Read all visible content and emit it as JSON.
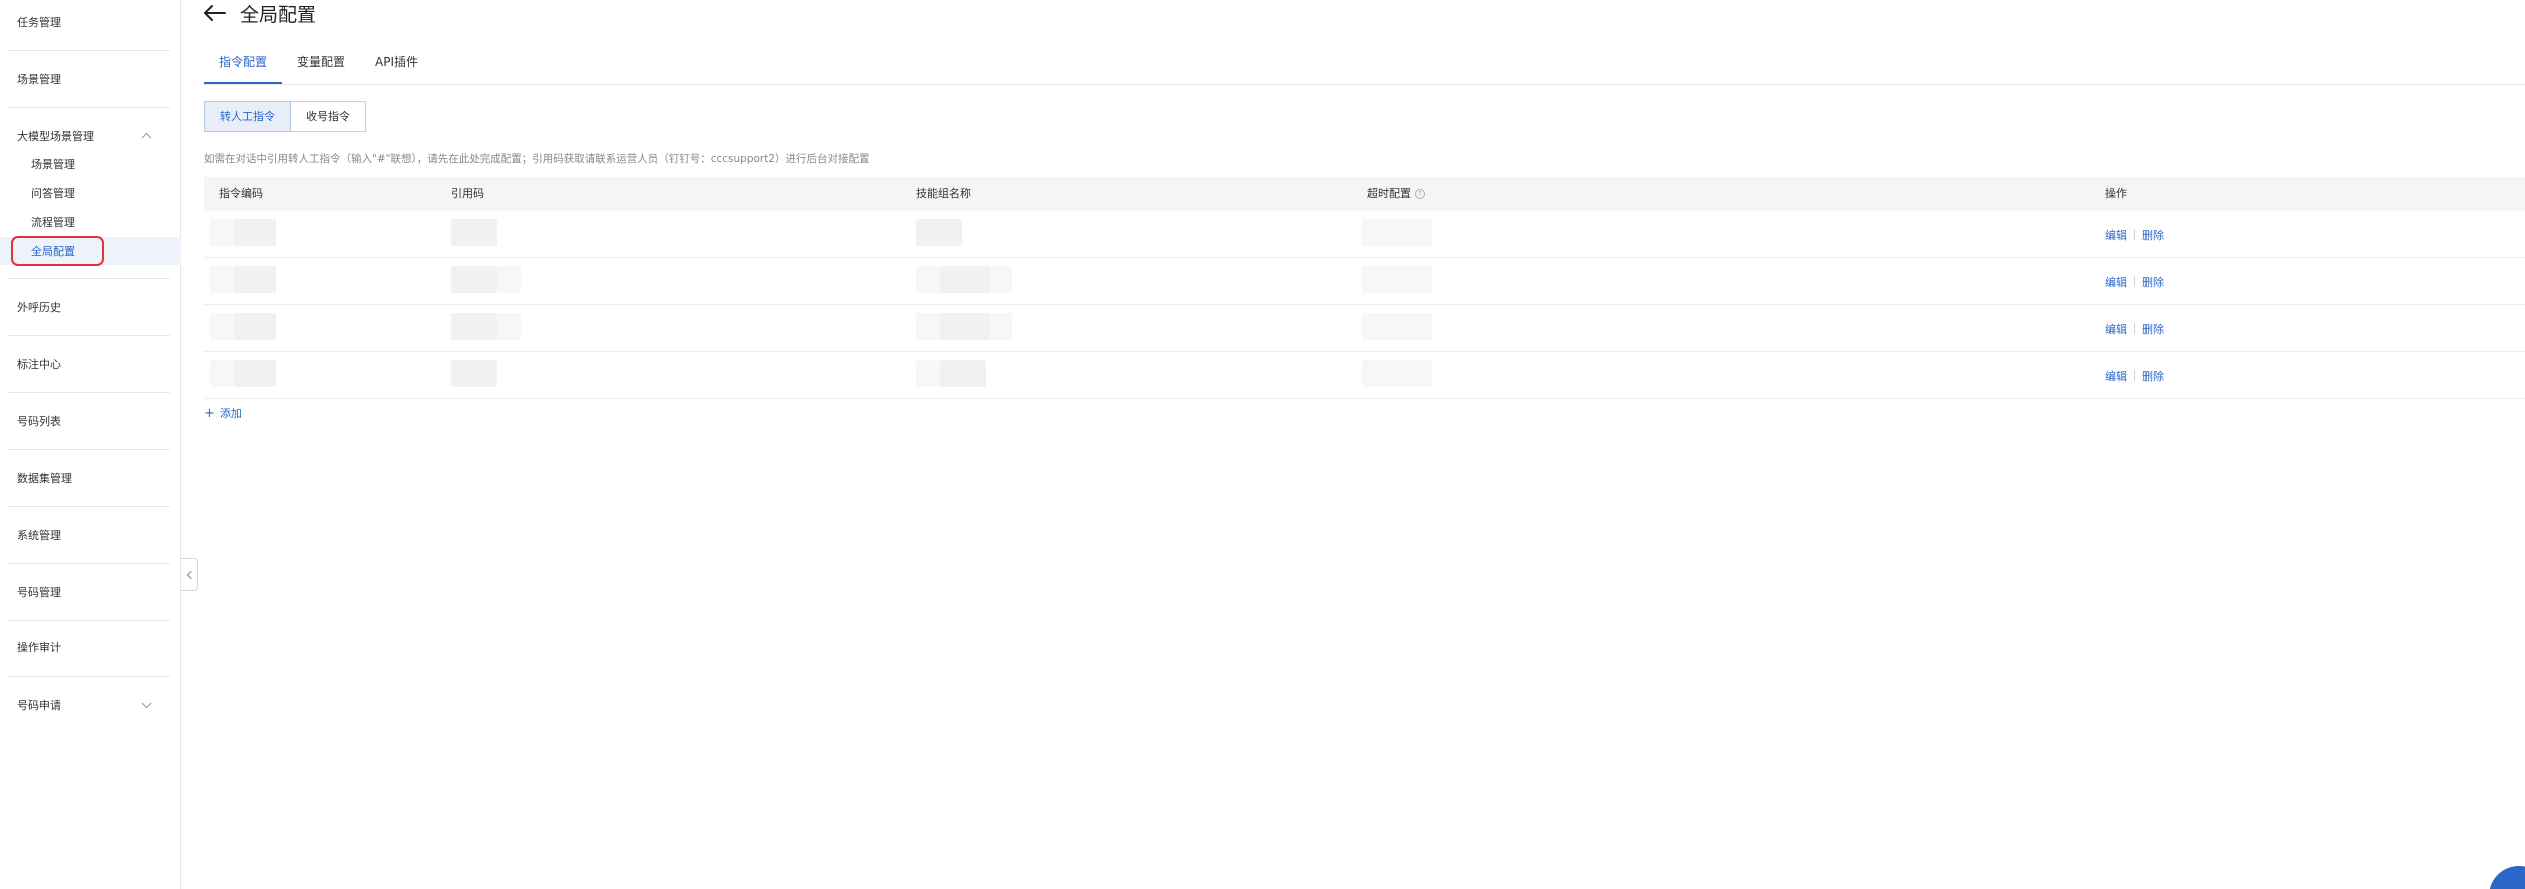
{
  "sidebar": {
    "items": [
      {
        "label": "任务管理"
      },
      {
        "label": "场景管理"
      },
      {
        "label": "大模型场景管理",
        "expanded": true,
        "children": [
          {
            "label": "场景管理"
          },
          {
            "label": "问答管理"
          },
          {
            "label": "流程管理"
          },
          {
            "label": "全局配置",
            "active": true
          }
        ]
      },
      {
        "label": "外呼历史"
      },
      {
        "label": "标注中心"
      },
      {
        "label": "号码列表"
      },
      {
        "label": "数据集管理"
      },
      {
        "label": "系统管理"
      },
      {
        "label": "号码管理"
      },
      {
        "label": "操作审计"
      },
      {
        "label": "号码申请",
        "expanded": false
      }
    ]
  },
  "header": {
    "title": "全局配置",
    "back_icon": "arrow-left-icon"
  },
  "tabs": [
    {
      "label": "指令配置",
      "active": true
    },
    {
      "label": "变量配置"
    },
    {
      "label": "API插件"
    }
  ],
  "segments": [
    {
      "label": "转人工指令",
      "active": true
    },
    {
      "label": "收号指令"
    }
  ],
  "hint": "如需在对话中引用转人工指令（输入\"#\"联想），请先在此处完成配置；引用码获取请联系运营人员（钉钉号：cccsupport2）进行后台对接配置",
  "table": {
    "columns": [
      "指令编码",
      "引用码",
      "技能组名称",
      "超时配置",
      "操作"
    ],
    "help_icon": "question-circle-icon",
    "rows": [
      {
        "edit": "编辑",
        "delete": "删除"
      },
      {
        "edit": "编辑",
        "delete": "删除"
      },
      {
        "edit": "编辑",
        "delete": "删除"
      },
      {
        "edit": "编辑",
        "delete": "删除"
      }
    ]
  },
  "add_label": "添加",
  "colors": {
    "accent": "#2b67c8",
    "highlight_ring": "#e0343a"
  }
}
